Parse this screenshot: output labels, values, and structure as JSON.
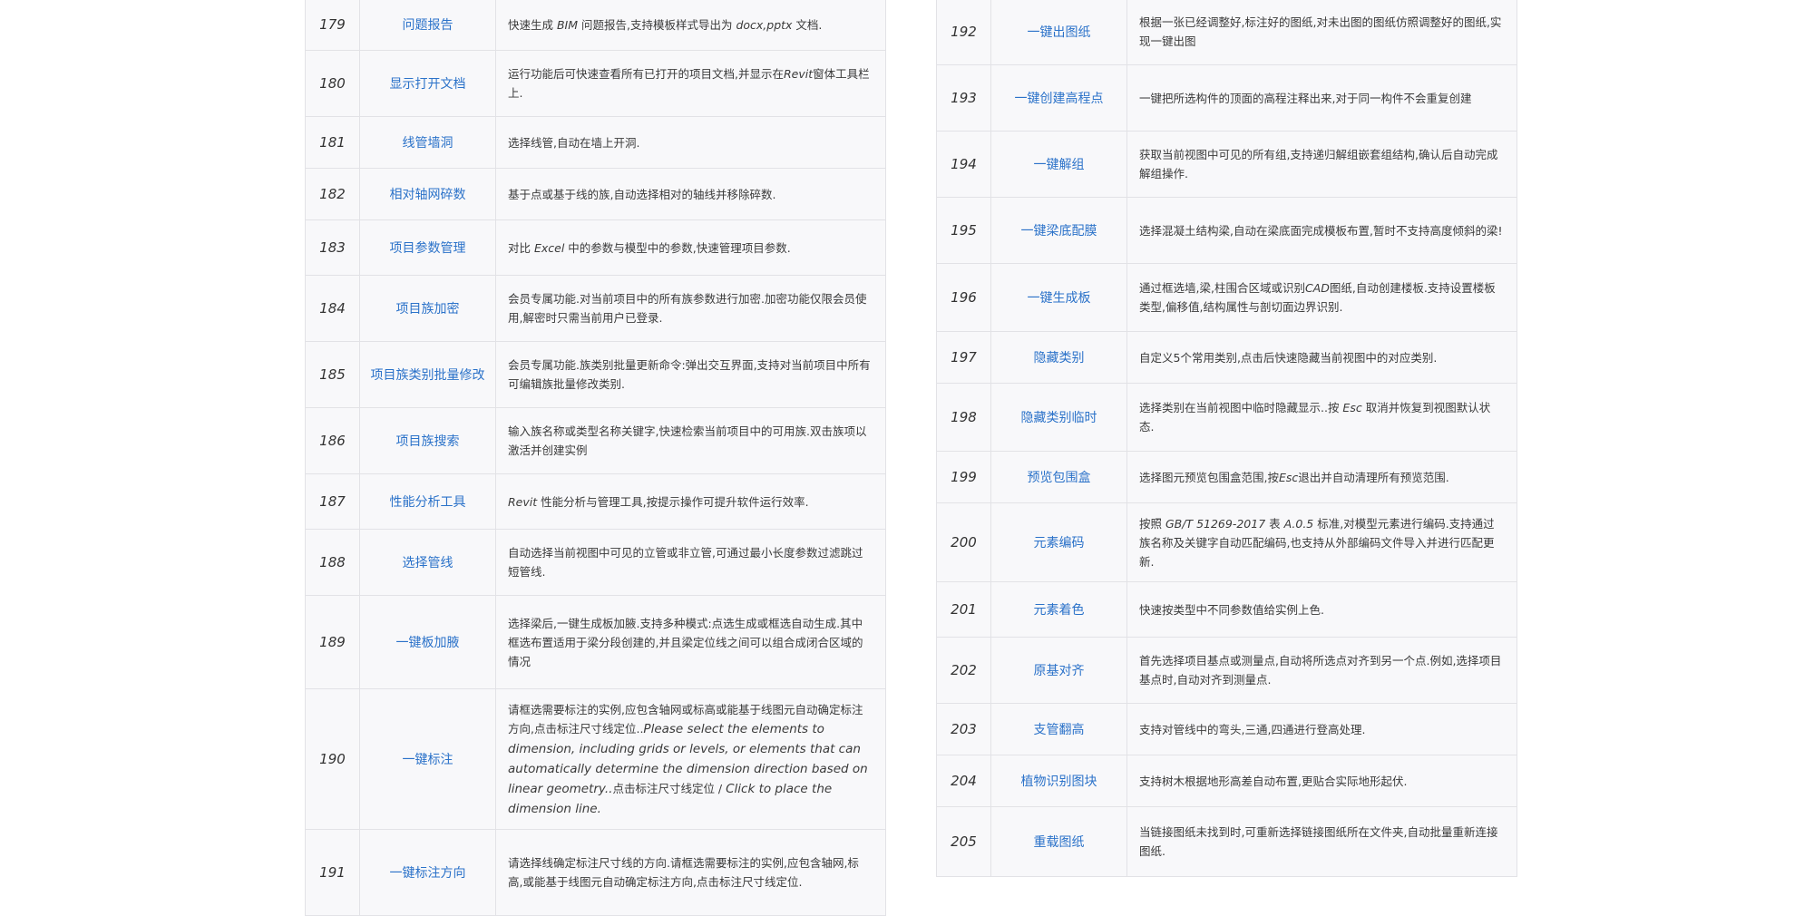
{
  "left_rows": [
    {
      "num": "179",
      "name": "问题报告",
      "desc": [
        {
          "t": "快速生成 "
        },
        {
          "t": "BIM",
          "i": true
        },
        {
          "t": " 问题报告,支持模板样式导出为 "
        },
        {
          "t": "docx,pptx",
          "i": true
        },
        {
          "t": " 文档."
        }
      ]
    },
    {
      "num": "180",
      "name": "显示打开文档",
      "desc": [
        {
          "t": "运行功能后可快速查看所有已打开的项目文档,并显示在"
        },
        {
          "t": "Revit",
          "i": true
        },
        {
          "t": "窗体工具栏上."
        }
      ]
    },
    {
      "num": "181",
      "name": "线管墙洞",
      "desc": [
        {
          "t": "选择线管,自动在墙上开洞."
        }
      ]
    },
    {
      "num": "182",
      "name": "相对轴网碎数",
      "desc": [
        {
          "t": "基于点或基于线的族,自动选择相对的轴线并移除碎数."
        }
      ]
    },
    {
      "num": "183",
      "name": "项目参数管理",
      "desc": [
        {
          "t": "对比 "
        },
        {
          "t": "Excel",
          "i": true
        },
        {
          "t": " 中的参数与模型中的参数,快速管理项目参数."
        }
      ]
    },
    {
      "num": "184",
      "name": "项目族加密",
      "desc": [
        {
          "t": "会员专属功能.对当前项目中的所有族参数进行加密.加密功能仅限会员使用,解密时只需当前用户已登录."
        }
      ]
    },
    {
      "num": "185",
      "name": "项目族类别批量修改",
      "desc": [
        {
          "t": "会员专属功能.族类别批量更新命令:弹出交互界面,支持对当前项目中所有可编辑族批量修改类别."
        }
      ]
    },
    {
      "num": "186",
      "name": "项目族搜索",
      "desc": [
        {
          "t": "输入族名称或类型名称关键字,快速检索当前项目中的可用族.双击族项以激活并创建实例"
        }
      ]
    },
    {
      "num": "187",
      "name": "性能分析工具",
      "desc": [
        {
          "t": "Revit",
          "i": true
        },
        {
          "t": " 性能分析与管理工具,按提示操作可提升软件运行效率."
        }
      ]
    },
    {
      "num": "188",
      "name": "选择管线",
      "desc": [
        {
          "t": "自动选择当前视图中可见的立管或非立管,可通过最小长度参数过滤跳过短管线."
        }
      ]
    },
    {
      "num": "189",
      "name": "一键板加腋",
      "desc": [
        {
          "t": "选择梁后,一键生成板加腋.支持多种模式:点选生成或框选自动生成.其中框选布置适用于梁分段创建的,并且梁定位线之间可以组合成闭合区域的情况"
        }
      ]
    },
    {
      "num": "190",
      "name": "一键标注",
      "desc": [
        {
          "t": "请框选需要标注的实例,应包含轴网或标高或能基于线图元自动确定标注方向,点击标注尺寸线定位.."
        },
        {
          "t": "Please select the elements to dimension, including grids or levels, or elements that can automatically determine the dimension direction based on linear geometry..",
          "en": true
        },
        {
          "t": "点击标注尺寸线定位 / "
        },
        {
          "t": "Click to place the dimension line.",
          "en": true
        }
      ]
    },
    {
      "num": "191",
      "name": "一键标注方向",
      "desc": [
        {
          "t": "请选择线确定标注尺寸线的方向.请框选需要标注的实例,应包含轴网,标高,或能基于线图元自动确定标注方向,点击标注尺寸线定位."
        }
      ]
    }
  ],
  "right_rows": [
    {
      "num": "192",
      "name": "一键出图纸",
      "desc": [
        {
          "t": "根据一张已经调整好,标注好的图纸,对未出图的图纸仿照调整好的图纸,实现一键出图"
        }
      ]
    },
    {
      "num": "193",
      "name": "一键创建高程点",
      "desc": [
        {
          "t": "一键把所选构件的顶面的高程注释出来,对于同一构件不会重复创建"
        }
      ]
    },
    {
      "num": "194",
      "name": "一键解组",
      "desc": [
        {
          "t": "获取当前视图中可见的所有组,支持递归解组嵌套组结构,确认后自动完成解组操作."
        }
      ]
    },
    {
      "num": "195",
      "name": "一键梁底配膜",
      "desc": [
        {
          "t": "选择混凝土结构梁,自动在梁底面完成模板布置,暂时不支持高度倾斜的梁!"
        }
      ]
    },
    {
      "num": "196",
      "name": "一键生成板",
      "desc": [
        {
          "t": "通过框选墙,梁,柱围合区域或识别"
        },
        {
          "t": "CAD",
          "i": true
        },
        {
          "t": "图纸,自动创建楼板.支持设置楼板类型,偏移值,结构属性与剖切面边界识别."
        }
      ]
    },
    {
      "num": "197",
      "name": "隐藏类别",
      "desc": [
        {
          "t": "自定义5个常用类别,点击后快速隐藏当前视图中的对应类别."
        }
      ]
    },
    {
      "num": "198",
      "name": "隐藏类别临时",
      "desc": [
        {
          "t": "选择类别在当前视图中临时隐藏显示..按 "
        },
        {
          "t": "Esc",
          "i": true
        },
        {
          "t": " 取消并恢复到视图默认状态."
        }
      ]
    },
    {
      "num": "199",
      "name": "预览包围盒",
      "desc": [
        {
          "t": "选择图元预览包围盒范围,按"
        },
        {
          "t": "Esc",
          "i": true
        },
        {
          "t": "退出并自动清理所有预览范围."
        }
      ]
    },
    {
      "num": "200",
      "name": "元素编码",
      "desc": [
        {
          "t": "按照 "
        },
        {
          "t": "GB/T 51269-2017",
          "i": true
        },
        {
          "t": " 表 "
        },
        {
          "t": "A.0.5",
          "i": true
        },
        {
          "t": " 标准,对模型元素进行编码.支持通过族名称及关键字自动匹配编码,也支持从外部编码文件导入并进行匹配更新."
        }
      ]
    },
    {
      "num": "201",
      "name": "元素着色",
      "desc": [
        {
          "t": "快速按类型中不同参数值给实例上色."
        }
      ]
    },
    {
      "num": "202",
      "name": "原基对齐",
      "desc": [
        {
          "t": "首先选择项目基点或测量点,自动将所选点对齐到另一个点.例如,选择项目基点时,自动对齐到测量点."
        }
      ]
    },
    {
      "num": "203",
      "name": "支管翻高",
      "desc": [
        {
          "t": "支持对管线中的弯头,三通,四通进行登高处理."
        }
      ]
    },
    {
      "num": "204",
      "name": "植物识别图块",
      "desc": [
        {
          "t": "支持树木根据地形高差自动布置,更贴合实际地形起伏."
        }
      ]
    },
    {
      "num": "205",
      "name": "重载图纸",
      "desc": [
        {
          "t": "当链接图纸未找到时,可重新选择链接图纸所在文件夹,自动批量重新连接图纸."
        }
      ]
    }
  ]
}
